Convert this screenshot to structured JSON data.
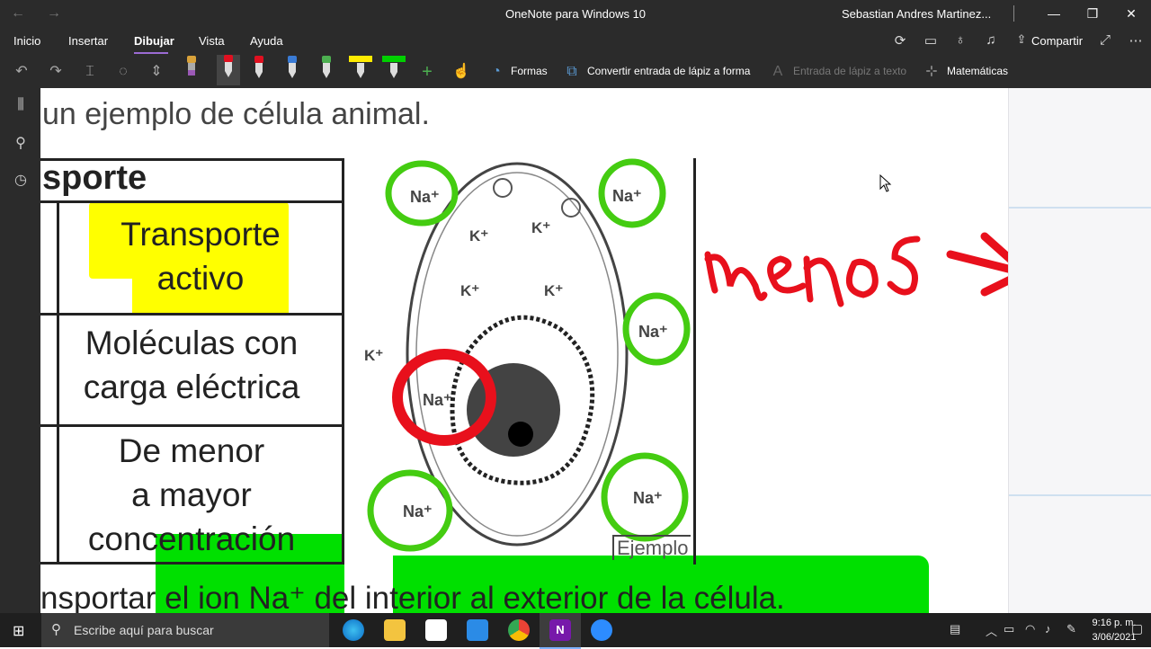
{
  "titlebar": {
    "back_icon": "back-arrow-icon",
    "forward_icon": "forward-arrow-icon",
    "app_title": "OneNote para Windows 10",
    "user_name": "Sebastian Andres Martinez...",
    "minimize": "—",
    "restore": "❐",
    "close": "✕"
  },
  "menu": {
    "items": [
      "Inicio",
      "Insertar",
      "Dibujar",
      "Vista",
      "Ayuda"
    ],
    "active": "Dibujar",
    "share_label": "Compartir"
  },
  "toolbar": {
    "shapes_label": "Formas",
    "convert_label": "Convertir entrada de lápiz a forma",
    "ink_to_text_label": "Entrada de lápiz a texto",
    "math_label": "Matemáticas",
    "pen_colors": [
      "#9b59b6",
      "#e01020",
      "#e01020",
      "#3a7bd5",
      "#4caf50",
      "#ffeb00",
      "#00d000"
    ]
  },
  "page": {
    "heading": "un ejemplo de célula animal.",
    "table": {
      "header": "sporte",
      "row1": [
        "Transporte",
        "activo"
      ],
      "row2": [
        "Moléculas con",
        "carga eléctrica"
      ],
      "row3": [
        "De menor",
        "a mayor",
        "concentración"
      ]
    },
    "diagram": {
      "na_labels": [
        "Na⁺",
        "Na⁺",
        "Na⁺",
        "Na⁺",
        "Na⁺",
        "Na⁺"
      ],
      "k_labels": [
        "K⁺",
        "K⁺",
        "K⁺",
        "K⁺",
        "K⁺"
      ],
      "example_label": "Ejemplo"
    },
    "bottom_text": "nsportar el ion Na⁺ del interior al exterior de la célula.",
    "handwriting": "menos → más"
  },
  "taskbar": {
    "search_placeholder": "Escribe aquí para buscar",
    "time": "9:16 p. m.",
    "date": "3/06/2021"
  }
}
